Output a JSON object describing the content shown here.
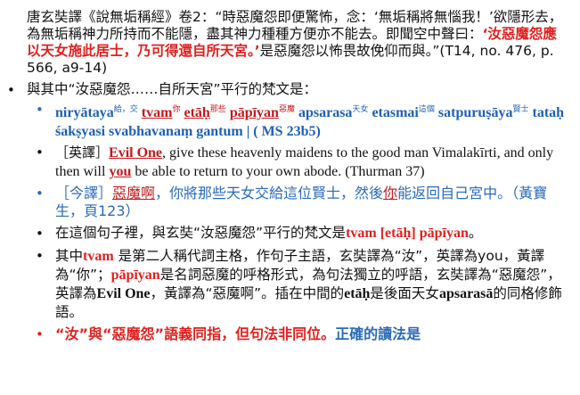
{
  "quote": {
    "p1": "唐玄奘譯《說無垢稱經》卷2：“時惡魔怨即便驚怖，念：‘無垢稱將無惱我！’欲隱形去，為無垢稱神力所持而不能隱，盡其神力種種方便亦不能去。即聞空中聲曰：",
    "p2_red": "‘汝惡魔怨應以天女施此居士，乃可得還自所天宮。’",
    "p3": "是惡魔怨以怖畏故俛仰而與。”(T14, no. 476, p. 566, a9-14)"
  },
  "b1": {
    "text": "與其中“汝惡魔怨……自所天宮”平行的梵文是："
  },
  "skt": {
    "w1": "niryātaya",
    "g1": "給，交",
    "w2": "tvam",
    "g2": "你",
    "w3": "etāḥ",
    "g3": "那些",
    "w4": "pāpīyan",
    "g4": "惡魔",
    "w5": "apsarasa",
    "g5": "天女",
    "w6": "etasmai",
    "g6": "這個",
    "w7": "satpuruṣāya",
    "g7": "賢士",
    "rest": "tataḥ śakṣyasi svabhavanaṃ gantum | ( MS 23b5)"
  },
  "eng": {
    "label": "［英譯］",
    "evil": "Evil One",
    "t1": ", give these heavenly maidens to the good man Vimalakīrti, and only then will ",
    "you": "you",
    "t2": " be able to return to your own abode. (Thurman 37)"
  },
  "modern": {
    "label": "［今譯］",
    "evil": "惡魔啊",
    "t1": "，你將那些天女交給這位賢士，然後",
    "you": "你",
    "t2": "能返回自己宮中。（黃寶生，頁123）"
  },
  "b2": {
    "text": "在這個句子裡，與玄奘“汝惡魔怨”平行的梵文是",
    "red": "tvam [etāḥ] pāpīyan",
    "end": "。"
  },
  "b3": {
    "a": "其中",
    "tvam": "tvam",
    "b": " 是第二人稱代詞主格，作句子主語，玄奘譯為“汝”，英譯為you，黃譯為“你”；",
    "papiyan": "pāpīyan",
    "c": "是名詞惡魔的呼格形式，為句法獨立的呼語，玄奘譯為“惡魔怨”，英譯為",
    "evil": "Evil One",
    "d": "，黃譯為“惡魔啊”。插在中間的",
    "etah": "etāḥ",
    "e": "是後面天女",
    "apsarasa": "apsarasā",
    "f": "的同格修飾語。"
  },
  "b4": {
    "red": "“汝”與“惡魔怨”語義同指，但句法非同位。",
    "blue": "正確的讀法是"
  }
}
